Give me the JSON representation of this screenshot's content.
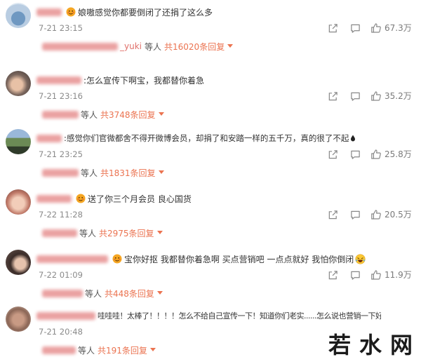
{
  "comments": [
    {
      "text": "娘嗷感觉你都要倒闭了还捐了这么多",
      "time": "7-21 23:15",
      "likes": "67.3万",
      "reply_name": "_yuki",
      "reply_who": "等人",
      "reply_count": "共16020条回复"
    },
    {
      "text": ":怎么宣传下啊宝，我都替你着急",
      "time": "7-21 23:16",
      "likes": "35.2万",
      "reply_who": "等人",
      "reply_count": "共3748条回复"
    },
    {
      "text": ":感觉你们官微都舍不得开微博会员，却捐了和安踏一样的五千万，真的很了不起",
      "time": "7-21 23:25",
      "likes": "25.8万",
      "reply_who": "等人",
      "reply_count": "共1831条回复"
    },
    {
      "text": "送了你三个月会员 良心国货",
      "time": "7-22 11:28",
      "likes": "20.5万",
      "reply_who": "等人",
      "reply_count": "共2975条回复"
    },
    {
      "text": "宝你好抠 我都替你着急啊 买点营销吧 一点点就好 我怕你倒闭",
      "time": "7-22 01:09",
      "likes": "11.9万",
      "reply_who": "等人",
      "reply_count": "共448条回复"
    },
    {
      "text": "哇哇哇！太棒了！！！！怎么不给自己宣传一下！知道你们老实......怎么说也营销一下好",
      "time": "7-21 20:48",
      "reply_who": "等人",
      "reply_count": "共191条回复"
    }
  ],
  "icons": {
    "share": "share-icon",
    "comment": "comment-icon",
    "like": "like-icon",
    "badge": "member-badge-icon",
    "expand": "chevron-down-icon",
    "laugh": "laughing-crying-emoji-icon",
    "drop": "drop-emoji-icon"
  },
  "watermark": "若水网",
  "colors": {
    "reply_count": "#eb7350",
    "time": "#8a8a8a",
    "text": "#333333"
  }
}
